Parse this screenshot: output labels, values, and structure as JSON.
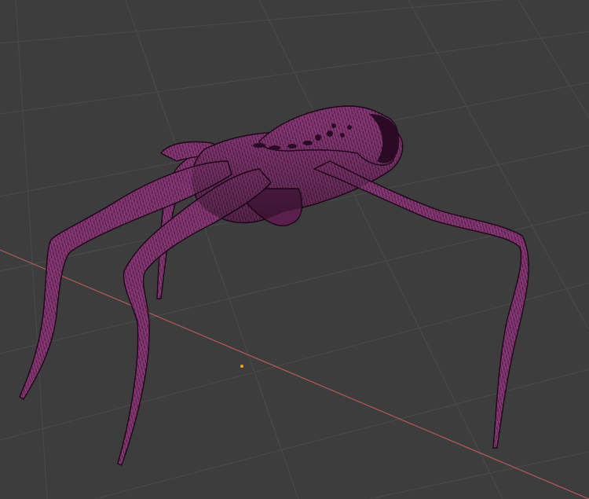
{
  "viewport": {
    "mode": "wireframe-over-solid",
    "background_color": "#3d3d3d",
    "grid_color": "#505050",
    "x_axis_color": "#c05a5a",
    "mesh_color": "#8a3a78",
    "mesh_dark_color": "#4a1a40",
    "wire_color": "#2a0a24"
  },
  "scene": {
    "object_icon": "creature-mesh",
    "origin_marker": "object-origin-dot"
  }
}
